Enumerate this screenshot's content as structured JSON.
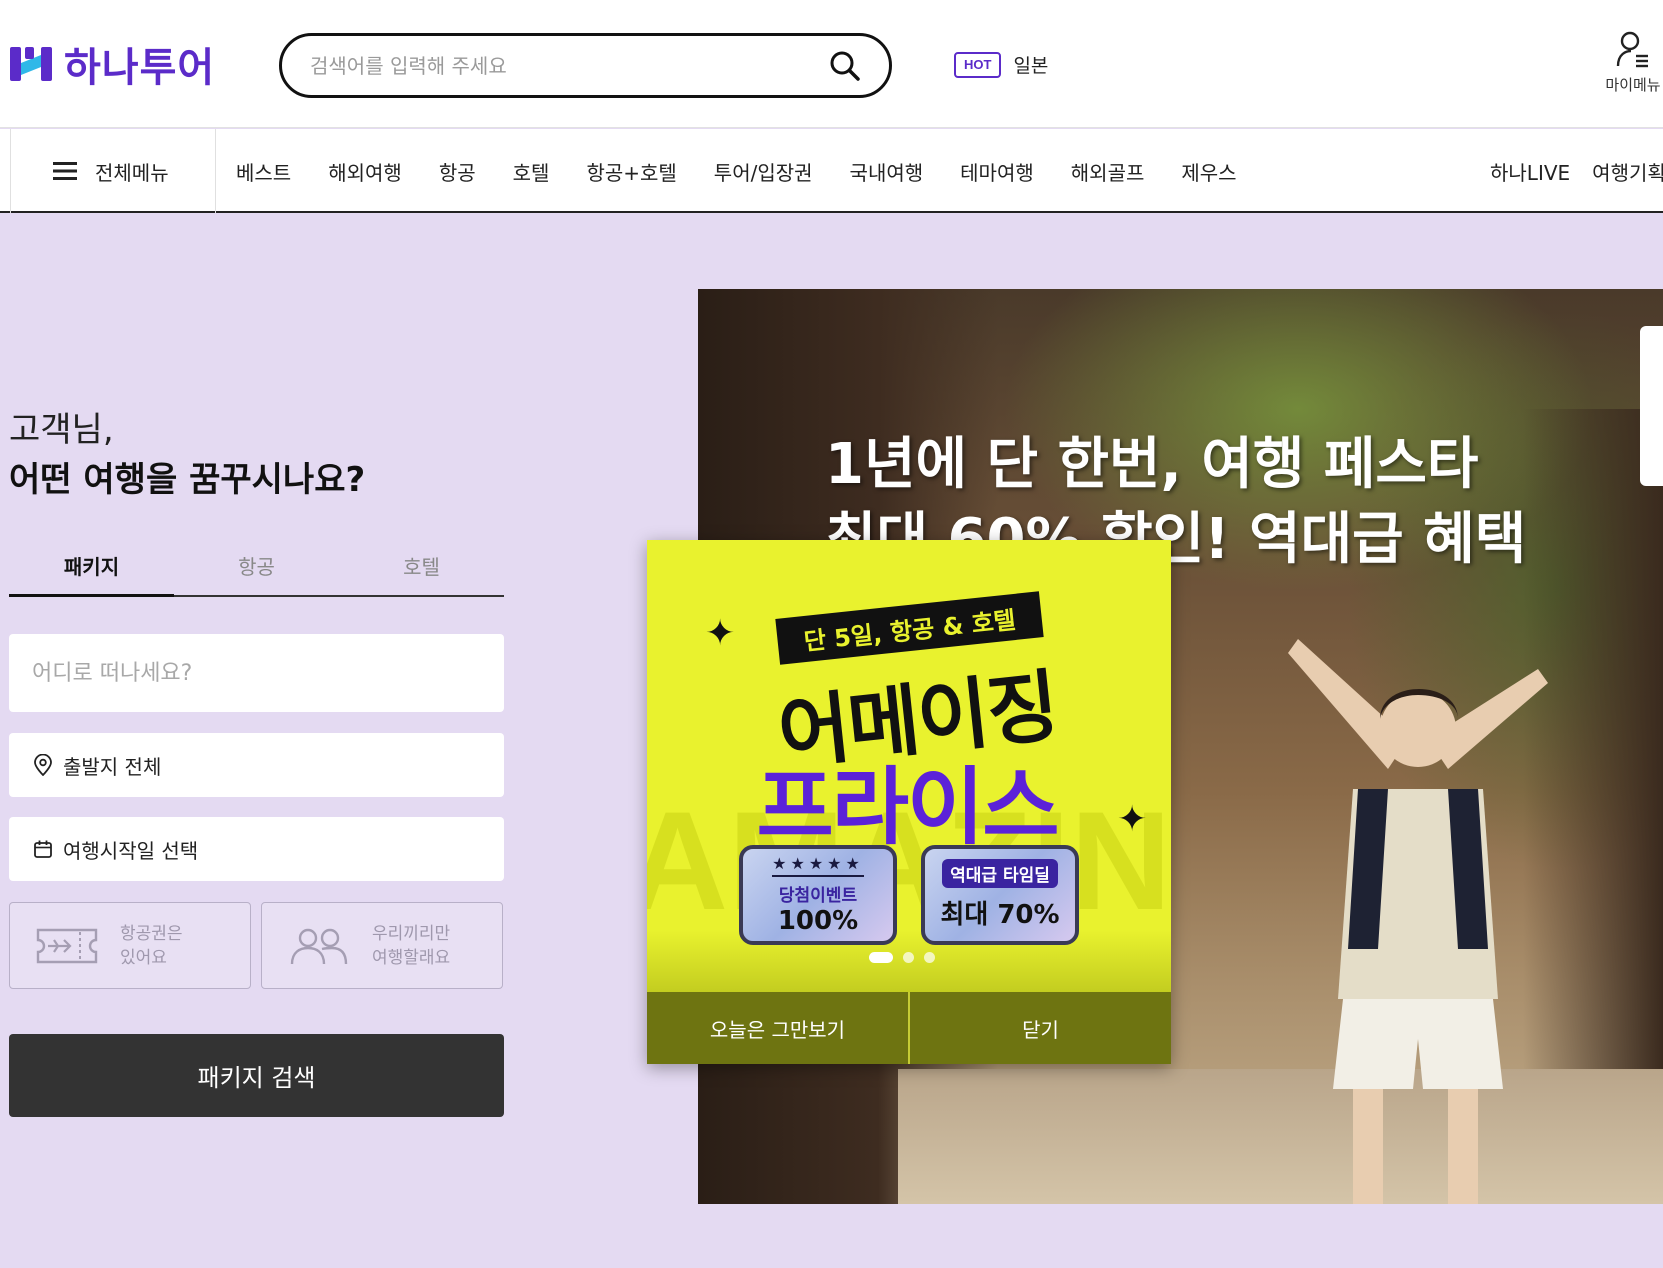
{
  "header": {
    "logo_text": "하나투어",
    "search_placeholder": "검색어를 입력해 주세요",
    "hot_badge": "HOT",
    "hot_keyword": "일본",
    "my_menu_label": "마이메뉴"
  },
  "nav": {
    "all_menu_label": "전체메뉴",
    "items": [
      "베스트",
      "해외여행",
      "항공",
      "호텔",
      "항공+호텔",
      "투어/입장권",
      "국내여행",
      "테마여행",
      "해외골프",
      "제우스"
    ],
    "right_items": [
      "하나LIVE",
      "여행기획"
    ]
  },
  "search_panel": {
    "greeting_line1": "고객님,",
    "greeting_line2": "어떤 여행을 꿈꾸시나요?",
    "tabs": [
      "패키지",
      "항공",
      "호텔"
    ],
    "active_tab": "패키지",
    "destination_placeholder": "어디로 떠나세요?",
    "departure_label": "출발지 전체",
    "date_label": "여행시작일 선택",
    "option_1_line1": "항공권은",
    "option_1_line2": "있어요",
    "option_2_line1": "우리끼리만",
    "option_2_line2": "여행할래요",
    "submit_label": "패키지 검색"
  },
  "banner": {
    "headline_1": "1년에 단 한번, 여행 페스타",
    "headline_2": "최대 60% 할인! 역대급 혜택"
  },
  "popup": {
    "ribbon_text": "단 5일, 항공 & 호텔",
    "title_1": "어메이징",
    "title_2": "프라이스",
    "sticker_1_stars": "★★★★★",
    "sticker_1_line1": "당첨이벤트",
    "sticker_1_line2": "100%",
    "sticker_2_tag": "역대급 타임딜",
    "sticker_2_line": "최대 70%",
    "slide_count": 3,
    "active_slide": 1,
    "dismiss_today_label": "오늘은 그만보기",
    "close_label": "닫기"
  },
  "colors": {
    "brand": "#5b2bc9",
    "page_bg": "#e4daf2",
    "popup_bg": "#e9f22e",
    "popup_action_bg": "#6e7411",
    "submit_bg": "#333333"
  }
}
